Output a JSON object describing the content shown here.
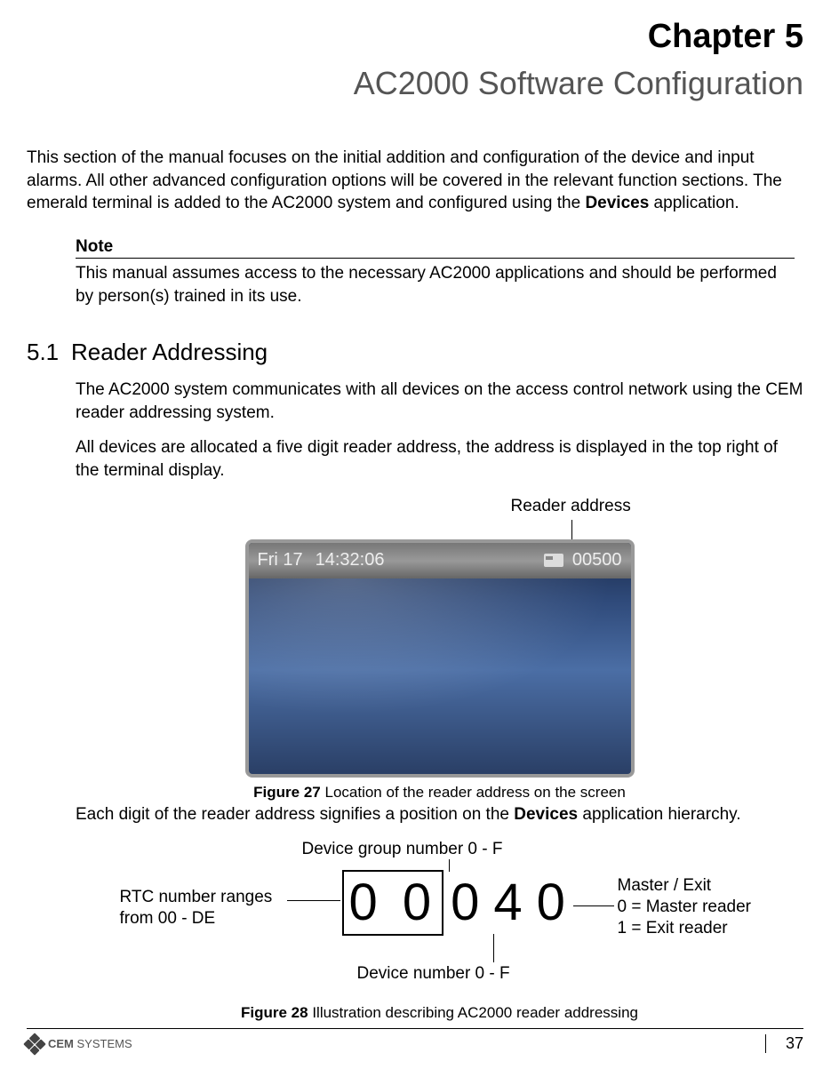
{
  "chapter_label": "Chapter 5",
  "chapter_title": "AC2000 Software Configuration",
  "intro_parts": {
    "p1": "This section of the manual focuses on the initial addition and configuration of the device and input alarms. All other advanced configuration options will be covered in the relevant function sections. The emerald terminal is added to the AC2000 system and configured using the ",
    "bold": "Devices",
    "p2": " application."
  },
  "note": {
    "heading": "Note",
    "body": "This manual assumes access to the necessary AC2000 applications and should be performed by person(s) trained in its use."
  },
  "section": {
    "number": "5.1",
    "title": "Reader Addressing",
    "p1": "The AC2000 system communicates with all devices on the access control network using the CEM reader addressing system.",
    "p2": "All devices are allocated a five digit reader address, the address is displayed in the top right of the terminal display.",
    "p3a": "Each digit of the reader address signifies a position on the ",
    "p3b": "Devices",
    "p3c": " application hierarchy."
  },
  "fig27": {
    "reader_label": "Reader address",
    "bar_day": "Fri 17",
    "bar_time": "14:32:06",
    "bar_addr": "00500",
    "caption_bold": "Figure 27",
    "caption_rest": " Location of the reader address on the screen"
  },
  "fig28": {
    "group_label": "Device group number 0 - F",
    "rtc_label_line1": "RTC number ranges",
    "rtc_label_line2": "from 00 - DE",
    "master_line1": "Master / Exit",
    "master_line2": "0 = Master reader",
    "master_line3": "1 = Exit reader",
    "device_num_label": "Device number 0 - F",
    "digits": {
      "rtc": "0 0",
      "d1": "0",
      "d2": "4",
      "d3": "0"
    },
    "caption_bold": "Figure 28",
    "caption_rest": " Illustration describing AC2000 reader addressing"
  },
  "footer": {
    "brand_bold": "CEM",
    "brand_rest": " SYSTEMS",
    "page_number": "37"
  }
}
